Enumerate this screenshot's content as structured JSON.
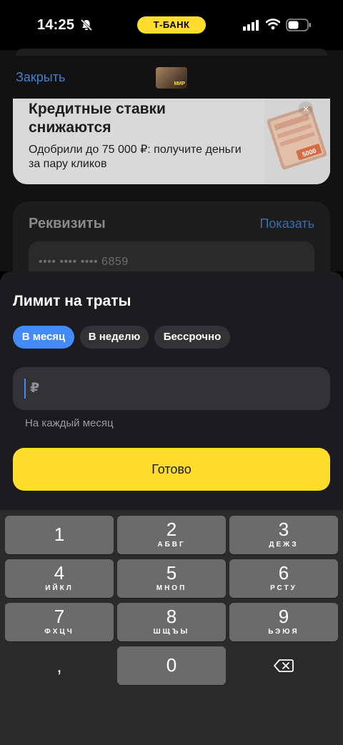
{
  "status_bar": {
    "time": "14:25",
    "bank_label": "Т-БАНК"
  },
  "background": {
    "close_label": "Закрыть",
    "thumb_label": "МИР",
    "promo": {
      "title": "Кредитные ставки снижаются",
      "subtitle": "Одобрили до 75 000 ₽: получите деньги за пару кликов",
      "close_symbol": "×",
      "banknote_value": "5000"
    },
    "requisites": {
      "title": "Реквизиты",
      "show_label": "Показать",
      "card_number": "•••• •••• •••• 6859"
    }
  },
  "sheet": {
    "title": "Лимит на траты",
    "periods": [
      {
        "label": "В месяц",
        "active": true
      },
      {
        "label": "В неделю",
        "active": false
      },
      {
        "label": "Бессрочно",
        "active": false
      }
    ],
    "amount": {
      "currency": "₽",
      "value": ""
    },
    "hint": "На каждый месяц",
    "done_label": "Готово"
  },
  "keyboard": {
    "keys": [
      {
        "num": "1",
        "letters": ""
      },
      {
        "num": "2",
        "letters": "АБВГ"
      },
      {
        "num": "3",
        "letters": "ДЕЖЗ"
      },
      {
        "num": "4",
        "letters": "ИЙКЛ"
      },
      {
        "num": "5",
        "letters": "МНОП"
      },
      {
        "num": "6",
        "letters": "РСТУ"
      },
      {
        "num": "7",
        "letters": "ФХЦЧ"
      },
      {
        "num": "8",
        "letters": "ШЩЪЫ"
      },
      {
        "num": "9",
        "letters": "ЬЭЮЯ"
      },
      {
        "num": ",",
        "letters": ""
      },
      {
        "num": "0",
        "letters": ""
      }
    ],
    "delete_icon": "backspace-icon"
  },
  "colors": {
    "accent_yellow": "#ffdd2d",
    "accent_blue": "#428bf9",
    "sheet_bg": "#1c1c1e",
    "key_bg": "#6b6b6b"
  }
}
